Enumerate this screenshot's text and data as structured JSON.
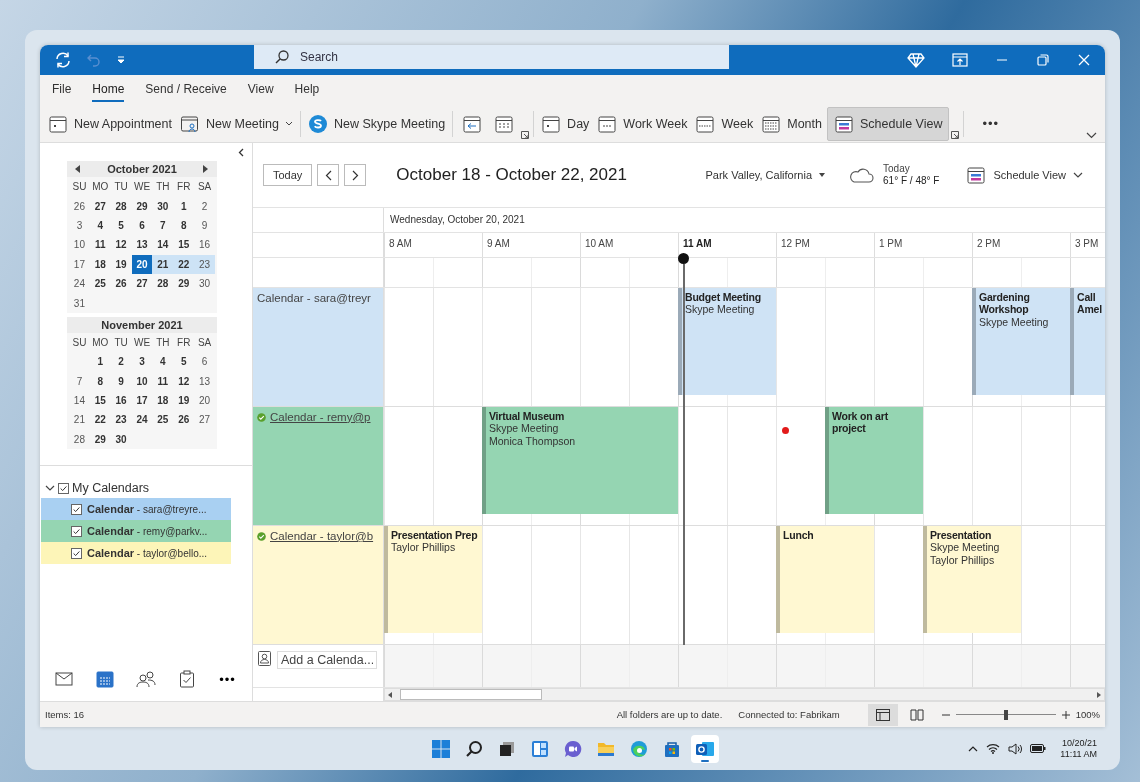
{
  "titlebar": {
    "undo": {
      "disabled": true
    },
    "search": {
      "placeholder": "Search"
    }
  },
  "ribbon": {
    "tabs": [
      {
        "label": "File",
        "selected": false
      },
      {
        "label": "Home",
        "selected": true
      },
      {
        "label": "Send / Receive",
        "selected": false
      },
      {
        "label": "View",
        "selected": false
      },
      {
        "label": "Help",
        "selected": false
      }
    ],
    "groups": [
      [
        {
          "kind": "appointment",
          "label": "New Appointment",
          "dropdown": false,
          "selected": false
        },
        {
          "kind": "meeting",
          "label": "New Meeting",
          "dropdown": true,
          "selected": false
        }
      ],
      [
        {
          "kind": "skype",
          "label": "New Skype Meeting",
          "dropdown": false,
          "selected": false
        }
      ],
      [
        {
          "kind": "go-today",
          "dropdown": false,
          "selected": false
        },
        {
          "kind": "next-days",
          "dropdown": false,
          "selected": false
        },
        {
          "kind": "launcher",
          "dropdown": false,
          "selected": false
        }
      ],
      [
        {
          "kind": "day",
          "label": "Day",
          "dropdown": false,
          "selected": false
        },
        {
          "kind": "workweek",
          "label": "Work Week",
          "dropdown": false,
          "selected": false
        },
        {
          "kind": "week",
          "label": "Week",
          "dropdown": false,
          "selected": false
        },
        {
          "kind": "month",
          "label": "Month",
          "dropdown": false,
          "selected": false
        },
        {
          "kind": "schedule",
          "label": "Schedule View",
          "dropdown": false,
          "selected": true
        },
        {
          "kind": "launcher",
          "dropdown": false,
          "selected": false
        }
      ],
      [
        {
          "kind": "more",
          "label": "•••",
          "dropdown": false,
          "selected": false
        }
      ]
    ]
  },
  "mini_calendars": [
    {
      "title": "October 2021",
      "nav": true,
      "weekdays": [
        "SU",
        "MO",
        "TU",
        "WE",
        "TH",
        "FR",
        "SA"
      ],
      "weeks": [
        [
          {
            "d": "26",
            "selected": false,
            "in_range": false
          },
          {
            "d": "27",
            "selected": false,
            "in_range": false
          },
          {
            "d": "28",
            "selected": false,
            "in_range": false
          },
          {
            "d": "29",
            "selected": false,
            "in_range": false
          },
          {
            "d": "30",
            "selected": false,
            "in_range": false
          },
          {
            "d": "1",
            "selected": false,
            "in_range": false
          },
          {
            "d": "2",
            "selected": false,
            "in_range": false
          }
        ],
        [
          {
            "d": "3",
            "selected": false,
            "in_range": false
          },
          {
            "d": "4",
            "selected": false,
            "in_range": false
          },
          {
            "d": "5",
            "selected": false,
            "in_range": false
          },
          {
            "d": "6",
            "selected": false,
            "in_range": false
          },
          {
            "d": "7",
            "selected": false,
            "in_range": false
          },
          {
            "d": "8",
            "selected": false,
            "in_range": false
          },
          {
            "d": "9",
            "selected": false,
            "in_range": false
          }
        ],
        [
          {
            "d": "10",
            "selected": false,
            "in_range": false
          },
          {
            "d": "11",
            "selected": false,
            "in_range": false
          },
          {
            "d": "12",
            "selected": false,
            "in_range": false
          },
          {
            "d": "13",
            "selected": false,
            "in_range": false
          },
          {
            "d": "14",
            "selected": false,
            "in_range": false
          },
          {
            "d": "15",
            "selected": false,
            "in_range": false
          },
          {
            "d": "16",
            "selected": false,
            "in_range": false
          }
        ],
        [
          {
            "d": "17",
            "selected": false,
            "in_range": false
          },
          {
            "d": "18",
            "selected": false,
            "in_range": false
          },
          {
            "d": "19",
            "selected": false,
            "in_range": false
          },
          {
            "d": "20",
            "selected": true,
            "in_range": true
          },
          {
            "d": "21",
            "selected": false,
            "in_range": true
          },
          {
            "d": "22",
            "selected": false,
            "in_range": true
          },
          {
            "d": "23",
            "selected": false,
            "in_range": true
          }
        ],
        [
          {
            "d": "24",
            "selected": false,
            "in_range": false
          },
          {
            "d": "25",
            "selected": false,
            "in_range": false
          },
          {
            "d": "26",
            "selected": false,
            "in_range": false
          },
          {
            "d": "27",
            "selected": false,
            "in_range": false
          },
          {
            "d": "28",
            "selected": false,
            "in_range": false
          },
          {
            "d": "29",
            "selected": false,
            "in_range": false
          },
          {
            "d": "30",
            "selected": false,
            "in_range": false
          }
        ],
        [
          {
            "d": "31",
            "selected": false,
            "in_range": false
          }
        ]
      ]
    },
    {
      "title": "November 2021",
      "nav": false,
      "weekdays": [
        "SU",
        "MO",
        "TU",
        "WE",
        "TH",
        "FR",
        "SA"
      ],
      "weeks": [
        [
          {
            "d": "1",
            "selected": false,
            "in_range": false
          },
          {
            "d": "2",
            "selected": false,
            "in_range": false
          },
          {
            "d": "3",
            "selected": false,
            "in_range": false
          },
          {
            "d": "4",
            "selected": false,
            "in_range": false
          },
          {
            "d": "5",
            "selected": false,
            "in_range": false
          },
          {
            "d": "6",
            "selected": false,
            "in_range": false
          }
        ],
        [
          {
            "d": "7",
            "selected": false,
            "in_range": false
          },
          {
            "d": "8",
            "selected": false,
            "in_range": false
          },
          {
            "d": "9",
            "selected": false,
            "in_range": false
          },
          {
            "d": "10",
            "selected": false,
            "in_range": false
          },
          {
            "d": "11",
            "selected": false,
            "in_range": false
          },
          {
            "d": "12",
            "selected": false,
            "in_range": false
          },
          {
            "d": "13",
            "selected": false,
            "in_range": false
          }
        ],
        [
          {
            "d": "14",
            "selected": false,
            "in_range": false
          },
          {
            "d": "15",
            "selected": false,
            "in_range": false
          },
          {
            "d": "16",
            "selected": false,
            "in_range": false
          },
          {
            "d": "17",
            "selected": false,
            "in_range": false
          },
          {
            "d": "18",
            "selected": false,
            "in_range": false
          },
          {
            "d": "19",
            "selected": false,
            "in_range": false
          },
          {
            "d": "20",
            "selected": false,
            "in_range": false
          }
        ],
        [
          {
            "d": "21",
            "selected": false,
            "in_range": false
          },
          {
            "d": "22",
            "selected": false,
            "in_range": false
          },
          {
            "d": "23",
            "selected": false,
            "in_range": false
          },
          {
            "d": "24",
            "selected": false,
            "in_range": false
          },
          {
            "d": "25",
            "selected": false,
            "in_range": false
          },
          {
            "d": "26",
            "selected": false,
            "in_range": false
          },
          {
            "d": "27",
            "selected": false,
            "in_range": false
          }
        ],
        [
          {
            "d": "28",
            "selected": false,
            "in_range": false
          },
          {
            "d": "29",
            "selected": false,
            "in_range": false
          },
          {
            "d": "30",
            "selected": false,
            "in_range": false
          }
        ]
      ]
    }
  ],
  "my_calendars": {
    "label": "My Calendars",
    "expanded": true,
    "checked": true,
    "items": [
      {
        "name": "Calendar",
        "account": " - sara@treyre...",
        "checked": true,
        "color": "#a9d0f2"
      },
      {
        "name": "Calendar",
        "account": " - remy@parkv...",
        "checked": true,
        "color": "#95d5b2"
      },
      {
        "name": "Calendar",
        "account": " - taylor@bello...",
        "checked": true,
        "color": "#fdf5b8"
      }
    ]
  },
  "nav_bar": [
    {
      "kind": "mail",
      "selected": false
    },
    {
      "kind": "calendar",
      "selected": true
    },
    {
      "kind": "people",
      "selected": false
    },
    {
      "kind": "tasks",
      "selected": false
    },
    {
      "kind": "more",
      "label": "•••",
      "selected": false
    }
  ],
  "schedule": {
    "today_button": "Today",
    "range_title": "October 18 - October 22, 2021",
    "location": "Park Valley, California",
    "weather": {
      "label": "Today",
      "temps": "61° F / 48° F"
    },
    "view_menu": "Schedule View",
    "date_heading": "Wednesday, October 20, 2021",
    "hours": [
      {
        "label": "8 AM",
        "current": false
      },
      {
        "label": "9 AM",
        "current": false
      },
      {
        "label": "10 AM",
        "current": false
      },
      {
        "label": "11 AM",
        "current": true
      },
      {
        "label": "12 PM",
        "current": false
      },
      {
        "label": "1 PM",
        "current": false
      },
      {
        "label": "2 PM",
        "current": false
      },
      {
        "label": "3 PM",
        "current": false
      }
    ],
    "calendars": [
      {
        "label": "Calendar - sara@treyr",
        "color": "#cfe3f5",
        "online": false,
        "slots": [
          {
            "busy": false
          },
          {
            "busy": false
          },
          {
            "busy": false
          },
          {
            "busy": false
          },
          {
            "busy": false
          },
          {
            "busy": false
          },
          {
            "busy": true,
            "event": {
              "title": "Budget Meeting",
              "details": [
                "Skype Meeting"
              ]
            }
          },
          {
            "busy": true
          },
          {
            "busy": false
          },
          {
            "busy": false
          },
          {
            "busy": false
          },
          {
            "busy": false
          },
          {
            "busy": true,
            "event": {
              "title": "Gardening Workshop",
              "details": [
                "Skype Meeting"
              ]
            }
          },
          {
            "busy": true
          },
          {
            "busy": true,
            "event": {
              "title": "Call Amel"
            }
          }
        ]
      },
      {
        "label": "Calendar - remy@p",
        "color": "#95d5b2",
        "online": true,
        "slots": [
          {
            "busy": false
          },
          {
            "busy": false
          },
          {
            "busy": true,
            "event": {
              "title": "Virtual Museum",
              "details": [
                "Skype Meeting",
                "Monica Thompson"
              ]
            }
          },
          {
            "busy": true
          },
          {
            "busy": true
          },
          {
            "busy": true
          },
          {
            "busy": false
          },
          {
            "busy": false
          },
          {
            "busy": false
          },
          {
            "busy": true,
            "event": {
              "title": "Work on art project"
            }
          },
          {
            "busy": true
          },
          {
            "busy": false
          },
          {
            "busy": false
          },
          {
            "busy": false
          },
          {
            "busy": false
          }
        ]
      },
      {
        "label": "Calendar - taylor@b",
        "color": "#fff8d2",
        "online": true,
        "slots": [
          {
            "busy": true,
            "event": {
              "title": "Presentation Prep",
              "details": [
                "Taylor Phillips"
              ]
            }
          },
          {
            "busy": true
          },
          {
            "busy": false
          },
          {
            "busy": false
          },
          {
            "busy": false
          },
          {
            "busy": false
          },
          {
            "busy": false
          },
          {
            "busy": false
          },
          {
            "busy": true,
            "event": {
              "title": "Lunch"
            }
          },
          {
            "busy": true
          },
          {
            "busy": false
          },
          {
            "busy": true,
            "event": {
              "title": "Presentation",
              "details": [
                "Skype Meeting",
                "Taylor Phillips"
              ]
            }
          },
          {
            "busy": true
          },
          {
            "busy": false
          },
          {
            "busy": false
          }
        ]
      }
    ],
    "add_calendar": {
      "placeholder": "Add a Calenda..."
    }
  },
  "status_bar": {
    "items": "Items: 16",
    "sync": "All folders are up to date.",
    "connection": "Connected to: Fabrikam",
    "zoom": {
      "level": 0.5,
      "reading": "100%"
    }
  },
  "taskbar": {
    "apps": [
      {
        "kind": "start",
        "active": false
      },
      {
        "kind": "search",
        "active": false
      },
      {
        "kind": "taskview",
        "active": false
      },
      {
        "kind": "widgets",
        "active": false
      },
      {
        "kind": "chat",
        "active": false
      },
      {
        "kind": "files",
        "active": false
      },
      {
        "kind": "browser",
        "active": false
      },
      {
        "kind": "store",
        "active": false
      },
      {
        "kind": "mail",
        "active": true
      }
    ],
    "date": "10/20/21",
    "time": "11:11 AM"
  }
}
